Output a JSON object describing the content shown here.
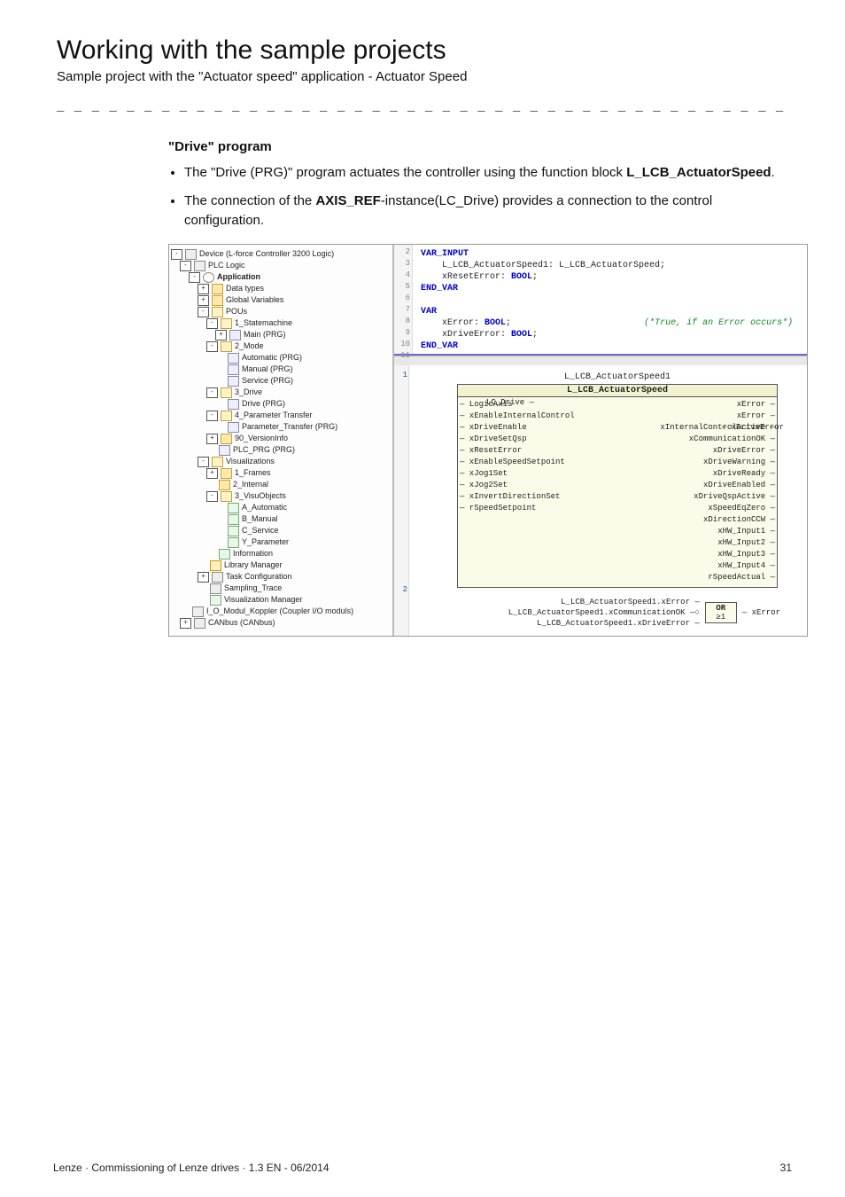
{
  "header": {
    "title": "Working with the sample projects",
    "subtitle": "Sample project with the \"Actuator speed\" application - Actuator Speed"
  },
  "section": {
    "heading": "\"Drive\" program",
    "bullet1_a": "The \"Drive (PRG)\" program actuates the controller using the function block ",
    "bullet1_b": "L_LCB_ActuatorSpeed",
    "bullet1_c": ".",
    "bullet2_a": "The connection of the ",
    "bullet2_b": "AXIS_REF",
    "bullet2_c": "-instance(LC_Drive) provides a connection to the control configuration."
  },
  "tree": [
    {
      "lvl": 0,
      "cls": "ic-dev",
      "text": "Device (L-force Controller 3200 Logic)",
      "exp": "-"
    },
    {
      "lvl": 1,
      "cls": "ic-dev",
      "text": "PLC Logic",
      "exp": "-"
    },
    {
      "lvl": 2,
      "cls": "ic-app",
      "text": "Application",
      "exp": "-",
      "bold": true
    },
    {
      "lvl": 3,
      "cls": "ic-folder",
      "text": "Data types",
      "exp": "+"
    },
    {
      "lvl": 3,
      "cls": "ic-folder",
      "text": "Global Variables",
      "exp": "+"
    },
    {
      "lvl": 3,
      "cls": "ic-folder-open",
      "text": "POUs",
      "exp": "-"
    },
    {
      "lvl": 4,
      "cls": "ic-folder-open",
      "text": "1_Statemachine",
      "exp": "-"
    },
    {
      "lvl": 5,
      "cls": "ic-pou",
      "text": "Main (PRG)",
      "exp": "+"
    },
    {
      "lvl": 4,
      "cls": "ic-folder-open",
      "text": "2_Mode",
      "exp": "-"
    },
    {
      "lvl": 5,
      "cls": "ic-pou",
      "text": "Automatic (PRG)"
    },
    {
      "lvl": 5,
      "cls": "ic-pou",
      "text": "Manual (PRG)"
    },
    {
      "lvl": 5,
      "cls": "ic-pou",
      "text": "Service (PRG)"
    },
    {
      "lvl": 4,
      "cls": "ic-folder-open",
      "text": "3_Drive",
      "exp": "-"
    },
    {
      "lvl": 5,
      "cls": "ic-pou",
      "text": "Drive (PRG)"
    },
    {
      "lvl": 4,
      "cls": "ic-folder-open",
      "text": "4_Parameter Transfer",
      "exp": "-"
    },
    {
      "lvl": 5,
      "cls": "ic-pou",
      "text": "Parameter_Transfer (PRG)"
    },
    {
      "lvl": 4,
      "cls": "ic-folder",
      "text": "90_VersionInfo",
      "exp": "+"
    },
    {
      "lvl": 4,
      "cls": "ic-pou",
      "text": "PLC_PRG (PRG)"
    },
    {
      "lvl": 3,
      "cls": "ic-folder-open",
      "text": "Visualizations",
      "exp": "-"
    },
    {
      "lvl": 4,
      "cls": "ic-folder",
      "text": "1_Frames",
      "exp": "+"
    },
    {
      "lvl": 4,
      "cls": "ic-folder",
      "text": "2_Internal"
    },
    {
      "lvl": 4,
      "cls": "ic-folder-open",
      "text": "3_VisuObjects",
      "exp": "-"
    },
    {
      "lvl": 5,
      "cls": "ic-visu",
      "text": "A_Automatic"
    },
    {
      "lvl": 5,
      "cls": "ic-visu",
      "text": "B_Manual"
    },
    {
      "lvl": 5,
      "cls": "ic-visu",
      "text": "C_Service"
    },
    {
      "lvl": 5,
      "cls": "ic-visu",
      "text": "Y_Parameter"
    },
    {
      "lvl": 4,
      "cls": "ic-visu",
      "text": "Information"
    },
    {
      "lvl": 3,
      "cls": "ic-lib",
      "text": "Library Manager"
    },
    {
      "lvl": 3,
      "cls": "ic-dev",
      "text": "Task Configuration",
      "exp": "+"
    },
    {
      "lvl": 3,
      "cls": "ic-dev",
      "text": "Sampling_Trace"
    },
    {
      "lvl": 3,
      "cls": "ic-visu",
      "text": "Visualization Manager"
    },
    {
      "lvl": 1,
      "cls": "ic-dev",
      "text": "I_O_Modul_Koppler (Coupler I/O moduls)"
    },
    {
      "lvl": 1,
      "cls": "ic-dev",
      "text": "CANbus (CANbus)",
      "exp": "+"
    }
  ],
  "code": {
    "l3": "    L_LCB_ActuatorSpeed1: L_LCB_ActuatorSpeed;",
    "l4": "    xResetError: ",
    "l8": "    xError: ",
    "l9": "    xDriveError: ",
    "bool": "BOOL",
    "semi": ";",
    "kw_var_input": "VAR_INPUT",
    "kw_end_var": "END_VAR",
    "kw_var": "VAR",
    "comment": "(*True, if an Error occurs*)"
  },
  "fb": {
    "instance": "L_LCB_ActuatorSpeed1",
    "type": "L_LCB_ActuatorSpeed",
    "ext_left": "LC_Drive —",
    "inputs": [
      "LogicAxis",
      "xEnableInternalControl",
      "xDriveEnable",
      "xDriveSetQsp",
      "xResetError",
      "xEnableSpeedSetpoint",
      "xJog1Set",
      "xJog2Set",
      "xInvertDirectionSet",
      "rSpeedSetpoint"
    ],
    "outputs": [
      "xError",
      "xError",
      "xInternalControlActive",
      "xCommunicationOK",
      "xDriveError",
      "xDriveWarning",
      "xDriveReady",
      "xDriveEnabled",
      "xDriveQspActive",
      "xSpeedEqZero",
      "xDirectionCCW",
      "xHW_Input1",
      "xHW_Input2",
      "xHW_Input3",
      "xHW_Input4",
      "rSpeedActual"
    ],
    "ext_right": "— xDriveError"
  },
  "orblock": {
    "title": "OR",
    "sym": "≥1",
    "in1": "L_LCB_ActuatorSpeed1.xError —",
    "in2": "L_LCB_ActuatorSpeed1.xCommunicationOK —○",
    "in3": "L_LCB_ActuatorSpeed1.xDriveError —",
    "out": "— xError"
  },
  "footer": {
    "left": "Lenze · Commissioning of Lenze drives · 1.3 EN - 06/2014",
    "right": "31"
  }
}
